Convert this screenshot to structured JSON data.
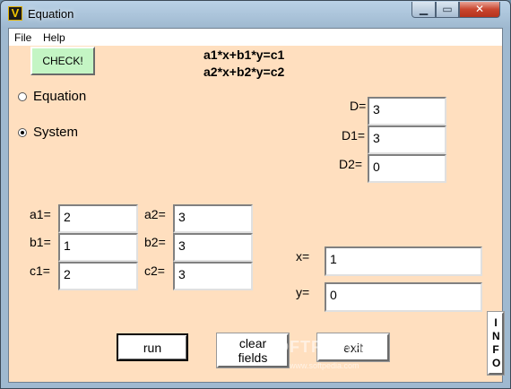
{
  "window": {
    "title": "Equation",
    "icon_letter": "V",
    "minimize": "▁",
    "maximize": "▭",
    "close": "✕"
  },
  "menu": {
    "file": "File",
    "help": "Help"
  },
  "check_button": "CHECK!",
  "formulas": {
    "line1": "a1*x+b1*y=c1",
    "line2": "a2*x+b2*y=c2"
  },
  "mode": {
    "equation_label": "Equation",
    "system_label": "System",
    "selected": "System"
  },
  "determinants": {
    "D": {
      "label": "D=",
      "value": "3"
    },
    "D1": {
      "label": "D1=",
      "value": "3"
    },
    "D2": {
      "label": "D2=",
      "value": "0"
    }
  },
  "coefficients": {
    "a1": {
      "label": "a1=",
      "value": "2"
    },
    "b1": {
      "label": "b1=",
      "value": "1"
    },
    "c1": {
      "label": "c1=",
      "value": "2"
    },
    "a2": {
      "label": "a2=",
      "value": "3"
    },
    "b2": {
      "label": "b2=",
      "value": "3"
    },
    "c2": {
      "label": "c2=",
      "value": "3"
    }
  },
  "results": {
    "x": {
      "label": "x=",
      "value": "1"
    },
    "y": {
      "label": "y=",
      "value": "0"
    }
  },
  "buttons": {
    "run": "run",
    "clear": "clear\nfields",
    "exit": "exit",
    "info": "INFO"
  },
  "watermark": {
    "text": "SOFTPEDIA",
    "sub": "www.softpedia.com"
  }
}
